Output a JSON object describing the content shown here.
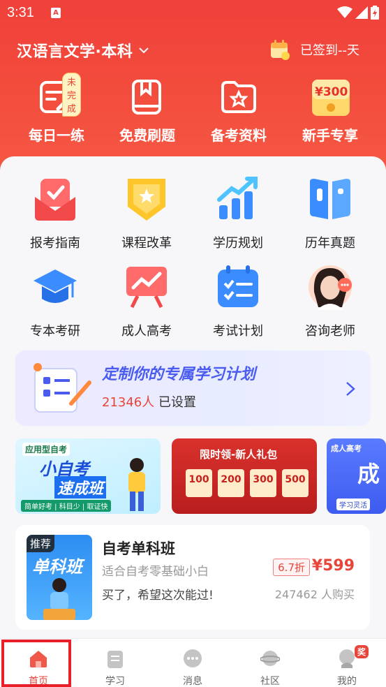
{
  "status_bar": {
    "time": "3:31",
    "app_icon_letter": "A"
  },
  "header": {
    "title": "汉语言文学·本科",
    "signin_text": "已签到--天"
  },
  "quick_actions": [
    {
      "label": "每日一练",
      "badge": "未完成",
      "icon": "edit-note-icon"
    },
    {
      "label": "免费刷题",
      "icon": "book-icon"
    },
    {
      "label": "备考资料",
      "icon": "star-folder-icon"
    },
    {
      "label": "新手专享",
      "icon": "red-envelope-icon",
      "amount": "¥300"
    }
  ],
  "grid": [
    {
      "label": "报考指南",
      "icon": "envelope-check-icon"
    },
    {
      "label": "课程改革",
      "icon": "star-badge-icon"
    },
    {
      "label": "学历规划",
      "icon": "growth-chart-icon"
    },
    {
      "label": "历年真题",
      "icon": "open-book-icon"
    },
    {
      "label": "专本考研",
      "icon": "graduation-cap-icon"
    },
    {
      "label": "成人高考",
      "icon": "presentation-board-icon"
    },
    {
      "label": "考试计划",
      "icon": "checklist-calendar-icon"
    },
    {
      "label": "咨询老师",
      "icon": "teacher-avatar-icon"
    }
  ],
  "plan_banner": {
    "title": "定制你的专属学习计划",
    "count": "21346人",
    "suffix": "已设置"
  },
  "promos": [
    {
      "tag": "应用型自考",
      "line1": "小自考",
      "line2": "速成班",
      "footer": "简单好考 | 科目少 | 取证快"
    },
    {
      "title": "限时领-新人礼包",
      "coupons": [
        "100",
        "200",
        "300",
        "500"
      ]
    },
    {
      "tag": "成人高考",
      "big": "成",
      "footer": "学习灵活"
    }
  ],
  "course": {
    "recommend": "推荐",
    "thumb_text": "单科班",
    "title": "自考单科班",
    "subtitle": "适合自考零基础小白",
    "note": "买了，希望这次能过!",
    "discount": "6.7折",
    "price": "¥599",
    "buyers": "247462 人购买"
  },
  "nav": [
    {
      "label": "首页",
      "icon": "home-icon",
      "active": true
    },
    {
      "label": "学习",
      "icon": "clipboard-icon"
    },
    {
      "label": "消息",
      "icon": "chat-icon"
    },
    {
      "label": "社区",
      "icon": "planet-icon"
    },
    {
      "label": "我的",
      "icon": "user-icon",
      "badge": "奖"
    }
  ],
  "colors": {
    "brand": "#f0403a",
    "accent_blue": "#4a5cf0",
    "price": "#e8453a"
  }
}
